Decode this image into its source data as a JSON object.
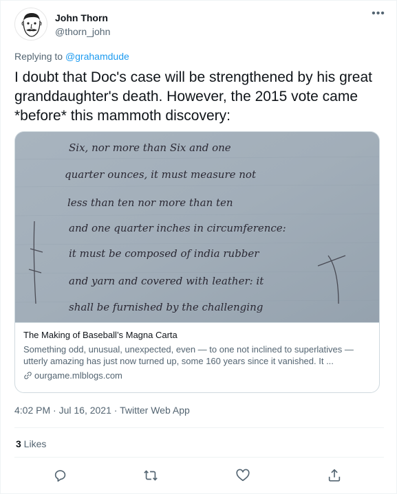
{
  "author": {
    "name": "John Thorn",
    "handle": "@thorn_john"
  },
  "more_label": "•••",
  "reply": {
    "prefix": "Replying to ",
    "mention": "@grahamdude"
  },
  "tweet_text": "I doubt that Doc's case will be strengthened by his great granddaughter's death. However, the 2015 vote came *before* this mammoth discovery:",
  "card": {
    "title": "The Making of Baseball’s Magna Carta",
    "description": "Something odd, unusual, unexpected, even — to one not inclined to superlatives — utterly amazing has just now turned up, some 160 years since it vanished. It ...",
    "domain": "ourgame.mlblogs.com",
    "image_lines": [
      "Six, nor more than Six and one",
      "quarter ounces, it must measure not",
      "less than ten nor more than ten",
      "and one quarter inches in circumference:",
      "it must be composed of india rubber",
      "and yarn and covered with leather: it",
      "shall be furnished by the challenging"
    ]
  },
  "meta": {
    "time": "4:02 PM",
    "sep1": " · ",
    "date": "Jul 16, 2021",
    "sep2": " · ",
    "source": "Twitter Web App"
  },
  "likes": {
    "count": "3",
    "label": " Likes"
  },
  "colors": {
    "accent": "#1d9bf0",
    "secondary_text": "#536471",
    "border": "#cfd9de"
  },
  "icons": [
    "reply-icon",
    "retweet-icon",
    "like-icon",
    "share-icon",
    "link-icon"
  ]
}
